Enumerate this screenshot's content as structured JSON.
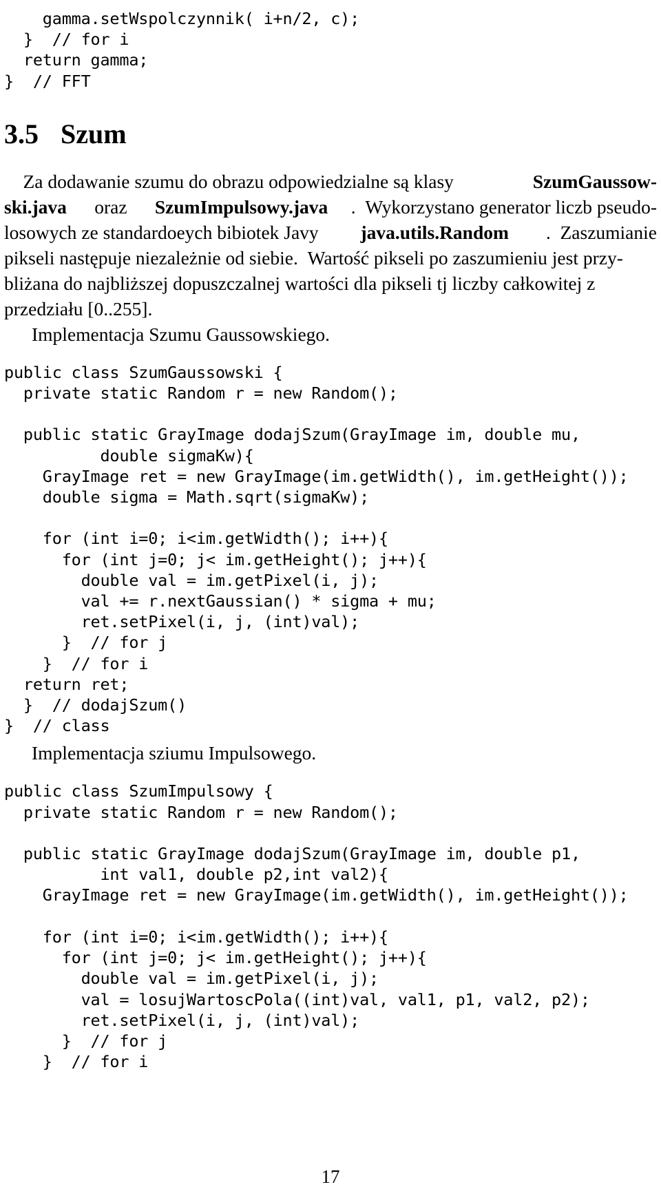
{
  "document": {
    "page_number": "17",
    "language": "pl"
  },
  "code_top": {
    "lines": [
      "    gamma.setWspolczynnik( i+n/2, c);",
      "  }  // for i",
      "  return gamma;",
      "}  // FFT"
    ]
  },
  "section": {
    "number": "3.5",
    "title": "Szum"
  },
  "paragraph1": {
    "lines": [
      [
        {
          "text": "    Za dodawanie szumu do obrazu odpowiedzialne są klasy ",
          "bold": false
        },
        {
          "text": "SzumGaussow-",
          "bold": true
        }
      ],
      [
        {
          "text": "ski.java",
          "bold": true
        },
        {
          "text": " oraz ",
          "bold": false
        },
        {
          "text": "SzumImpulsowy.java",
          "bold": true
        },
        {
          "text": ". Wykorzystano generator liczb pseudo-",
          "bold": false
        }
      ],
      [
        {
          "text": "losowych ze standardoeych bibiotek Javy ",
          "bold": false
        },
        {
          "text": "java.utils.Random",
          "bold": true
        },
        {
          "text": ". Zaszumianie",
          "bold": false
        }
      ],
      [
        {
          "text": "pikseli następuje niezależnie od siebie. Wartość pikseli po zaszumieniu jest przy-",
          "bold": false
        }
      ],
      [
        {
          "text": "bliżana do najbliższej dopuszczalnej wartości dla pikseli tj liczby całkowitej z",
          "bold": false
        }
      ],
      [
        {
          "text": "przedziału [0..255].",
          "bold": false
        }
      ]
    ]
  },
  "caption1": {
    "text": "Implementacja Szumu Gaussowskiego."
  },
  "code_gaussian": {
    "lines": [
      "public class SzumGaussowski {",
      "  private static Random r = new Random();",
      "",
      "  public static GrayImage dodajSzum(GrayImage im, double mu,",
      "          double sigmaKw){",
      "    GrayImage ret = new GrayImage(im.getWidth(), im.getHeight());",
      "    double sigma = Math.sqrt(sigmaKw);",
      "",
      "    for (int i=0; i<im.getWidth(); i++){",
      "      for (int j=0; j< im.getHeight(); j++){",
      "        double val = im.getPixel(i, j);",
      "        val += r.nextGaussian() * sigma + mu;",
      "        ret.setPixel(i, j, (int)val);",
      "      }  // for j",
      "    }  // for i",
      "  return ret;",
      "  }  // dodajSzum()",
      "}  // class"
    ]
  },
  "caption2": {
    "text": "Implementacja sziumu Impulsowego."
  },
  "code_impulse": {
    "lines": [
      "public class SzumImpulsowy {",
      "  private static Random r = new Random();",
      "",
      "  public static GrayImage dodajSzum(GrayImage im, double p1,",
      "          int val1, double p2,int val2){",
      "    GrayImage ret = new GrayImage(im.getWidth(), im.getHeight());",
      "",
      "    for (int i=0; i<im.getWidth(); i++){",
      "      for (int j=0; j< im.getHeight(); j++){",
      "        double val = im.getPixel(i, j);",
      "        val = losujWartoscPola((int)val, val1, p1, val2, p2);",
      "        ret.setPixel(i, j, (int)val);",
      "      }  // for j",
      "    }  // for i"
    ]
  }
}
